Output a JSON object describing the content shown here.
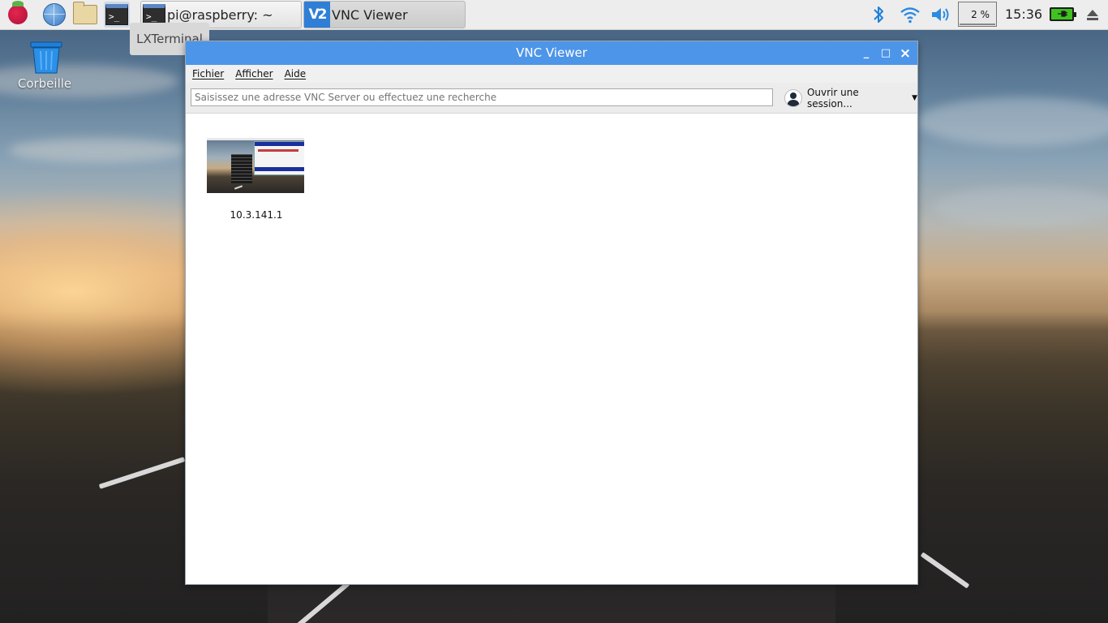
{
  "taskbar": {
    "launchers": [
      {
        "name": "raspberry-menu",
        "icon": "raspberry-icon"
      },
      {
        "name": "browser",
        "icon": "globe-icon"
      },
      {
        "name": "file-manager",
        "icon": "folder-icon"
      },
      {
        "name": "terminal",
        "icon": "terminal-icon",
        "glyph": ">_"
      }
    ],
    "tasks": [
      {
        "label": "pi@raspberry: ~",
        "icon": "terminal-icon",
        "glyph": ">_"
      },
      {
        "label": "VNC Viewer",
        "icon": "vnc-icon",
        "glyph": "V2"
      }
    ],
    "tooltip": "LXTerminal",
    "tray": {
      "cpu": "2 %",
      "clock": "15:36",
      "icons": [
        "bluetooth-icon",
        "wifi-icon",
        "volume-icon",
        "battery-icon",
        "eject-icon"
      ]
    }
  },
  "desktop": {
    "trash_label": "Corbeille"
  },
  "window": {
    "title": "VNC Viewer",
    "controls": {
      "minimize": "_",
      "maximize": "□",
      "close": "×"
    },
    "menu": [
      "Fichier",
      "Afficher",
      "Aide"
    ],
    "search": {
      "value": "",
      "placeholder": "Saisissez une adresse VNC Server ou effectuez une recherche"
    },
    "session": {
      "label": "Ouvrir une session...",
      "caret": "▼"
    },
    "connections": [
      {
        "label": "10.3.141.1"
      }
    ]
  },
  "colors": {
    "titlebar": "#4d95e8",
    "vnc_brand": "#2f7fd6",
    "battery": "#3ec31e"
  }
}
